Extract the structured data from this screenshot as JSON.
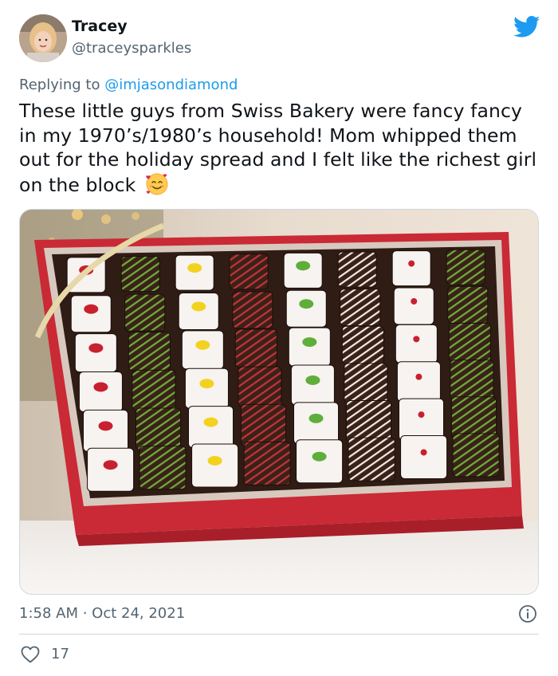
{
  "tweet": {
    "display_name": "Tracey",
    "handle": "@traceysparkles",
    "reply_prefix": "Replying to ",
    "reply_to": "@imjasondiamond",
    "text": "These little guys from Swiss Bakery were fancy fancy in my 1970’s/1980’s household! Mom whipped them out for the holiday spread and I felt like the richest girl on the block",
    "emoji": "smiling-face-with-hearts",
    "timestamp": "1:58 AM · Oct 24, 2021",
    "like_count": "17"
  },
  "icons": {
    "brand": "twitter-bird-icon",
    "info": "info-icon",
    "like": "heart-outline-icon"
  },
  "colors": {
    "brand_blue": "#1d9bf0",
    "text_primary": "#0f1419",
    "text_secondary": "#536471",
    "divider": "#cfd9de"
  }
}
